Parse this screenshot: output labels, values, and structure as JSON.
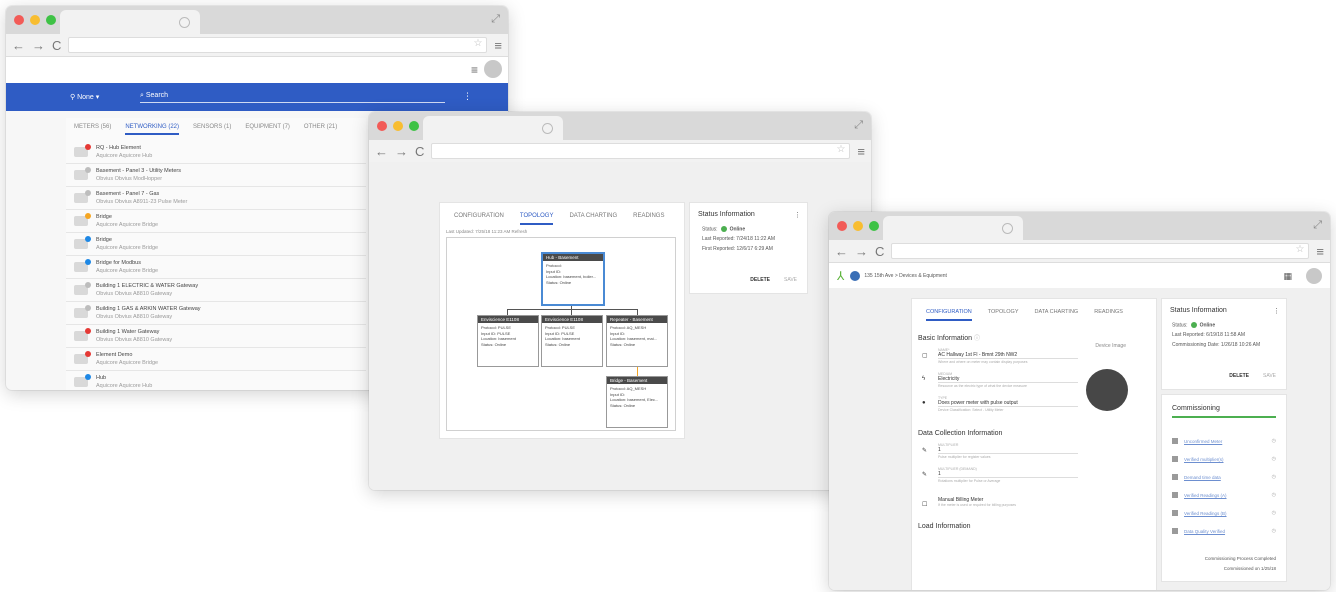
{
  "window1": {
    "filter_label": "None",
    "search_placeholder": "Search",
    "tabs": [
      "METERS (56)",
      "NETWORKING (22)",
      "SENSORS (1)",
      "EQUIPMENT (7)",
      "OTHER (21)"
    ],
    "rows": [
      {
        "name": "RQ - Hub Element",
        "sub": "Aquicore Aquicore Hub",
        "color": "#e53935"
      },
      {
        "name": "Basement - Panel 3 - Utility Meters",
        "sub": "Obvius Obvius ModHopper",
        "color": "#bdbdbd"
      },
      {
        "name": "Basement - Panel 7 - Gas",
        "sub": "Obvius Obvius A8911-23 Pulse Meter",
        "color": "#bdbdbd"
      },
      {
        "name": "Bridge",
        "sub": "Aquicore Aquicore Bridge",
        "color": "#f5a623"
      },
      {
        "name": "Bridge",
        "sub": "Aquicore Aquicore Bridge",
        "color": "#1e88e5"
      },
      {
        "name": "Bridge for Modbus",
        "sub": "Aquicore Aquicore Bridge",
        "color": "#1e88e5"
      },
      {
        "name": "Building 1 ELECTRIC & WATER Gateway",
        "sub": "Obvius Obvius A8810 Gateway",
        "color": "#bdbdbd"
      },
      {
        "name": "Building 1 GAS & ARKIN WATER Gateway",
        "sub": "Obvius Obvius A8810 Gateway",
        "color": "#bdbdbd"
      },
      {
        "name": "Building 1 Water Gateway",
        "sub": "Obvius Obvius A8810 Gateway",
        "color": "#e53935"
      },
      {
        "name": "Element Demo",
        "sub": "Aquicore Aquicore Bridge",
        "color": "#e53935"
      },
      {
        "name": "Hub",
        "sub": "Aquicore Aquicore Hub",
        "color": "#1e88e5"
      }
    ]
  },
  "window2": {
    "tabs": [
      "CONFIGURATION",
      "TOPOLOGY",
      "DATA CHARTING",
      "READINGS"
    ],
    "last_updated": "Last Updated: 7/25/18 11:23 AM Refresh",
    "nodes": [
      {
        "title": "Hub - Basement",
        "lines": [
          "Protocol:",
          "Input ID:",
          "Location: basement, boiler...",
          "Status: Online"
        ]
      },
      {
        "title": "Enviscience E1108",
        "lines": [
          "Protocol: PULSE",
          "Input ID: PULSE",
          "Location: basement",
          "Status: Online"
        ]
      },
      {
        "title": "Enviscience E1108",
        "lines": [
          "Protocol: PULSE",
          "Input ID: PULSE",
          "Location: basement",
          "Status: Online"
        ]
      },
      {
        "title": "Repeater - Basement",
        "lines": [
          "Protocol: AQ_MESH",
          "Input ID:",
          "Location: basement, mai...",
          "Status: Online"
        ]
      },
      {
        "title": "Bridge - Basement",
        "lines": [
          "Protocol: AQ_MESH",
          "Input ID:",
          "Location: basement, Elec...",
          "Status: Online"
        ]
      }
    ],
    "status": {
      "title": "Status Information",
      "status_label": "Status:",
      "status_value": "Online",
      "last_reported": "Last Reported: 7/24/18 11:22 AM",
      "first_reported": "First Reported: 12/6/17 6:29 AM",
      "delete": "DELETE",
      "save": "SAVE"
    }
  },
  "window3": {
    "breadcrumb": "135 15th Ave  >  Devices & Equipment",
    "tabs": [
      "CONFIGURATION",
      "TOPOLOGY",
      "DATA CHARTING",
      "READINGS"
    ],
    "basic_info_title": "Basic Information",
    "device_image_label": "Device Image",
    "fields": [
      {
        "label": "NAME*",
        "value": "AC Hallway 1st Fl - Bmnt 29th NW2",
        "hint": "Where and where on meter may contain display purposes"
      },
      {
        "label": "MEDIUM",
        "value": "Electricity",
        "hint": "Resource as the electric type of what the device measure"
      },
      {
        "label": "TYPE",
        "value": "Does power meter with pulse output",
        "hint": "Device Classification: Select - Utility Meter"
      }
    ],
    "data_collection_title": "Data Collection Information",
    "dc_fields": [
      {
        "label": "MULTIPLIER",
        "value": "1",
        "hint": "Pulse multiplier for register values"
      },
      {
        "label": "MULTIPLIER (DEMAND)",
        "value": "1",
        "hint": "Rotations multiplier for Pulse or Average"
      }
    ],
    "manual_billing": "Manual Billing Meter",
    "manual_billing_hint": "If the meter is used or required for billing purposes",
    "load_info_title": "Load Information",
    "status": {
      "title": "Status Information",
      "status_label": "Status:",
      "status_value": "Online",
      "last_reported": "Last Reported: 6/19/18 11:58 AM",
      "commissioning": "Commissioning Date: 1/26/18 10:26 AM",
      "delete": "DELETE",
      "save": "SAVE"
    },
    "commissioning": {
      "title": "Commissioning",
      "items": [
        "Unconfirmed Meter",
        "Verified multiplier(s)",
        "Demand time data",
        "Verified Readings (A)",
        "Verified Readings (B)",
        "Data Quality Verified"
      ],
      "completed": "Commissioning Process Completed",
      "completed_on": "Commissioned on 1/25/18"
    }
  }
}
